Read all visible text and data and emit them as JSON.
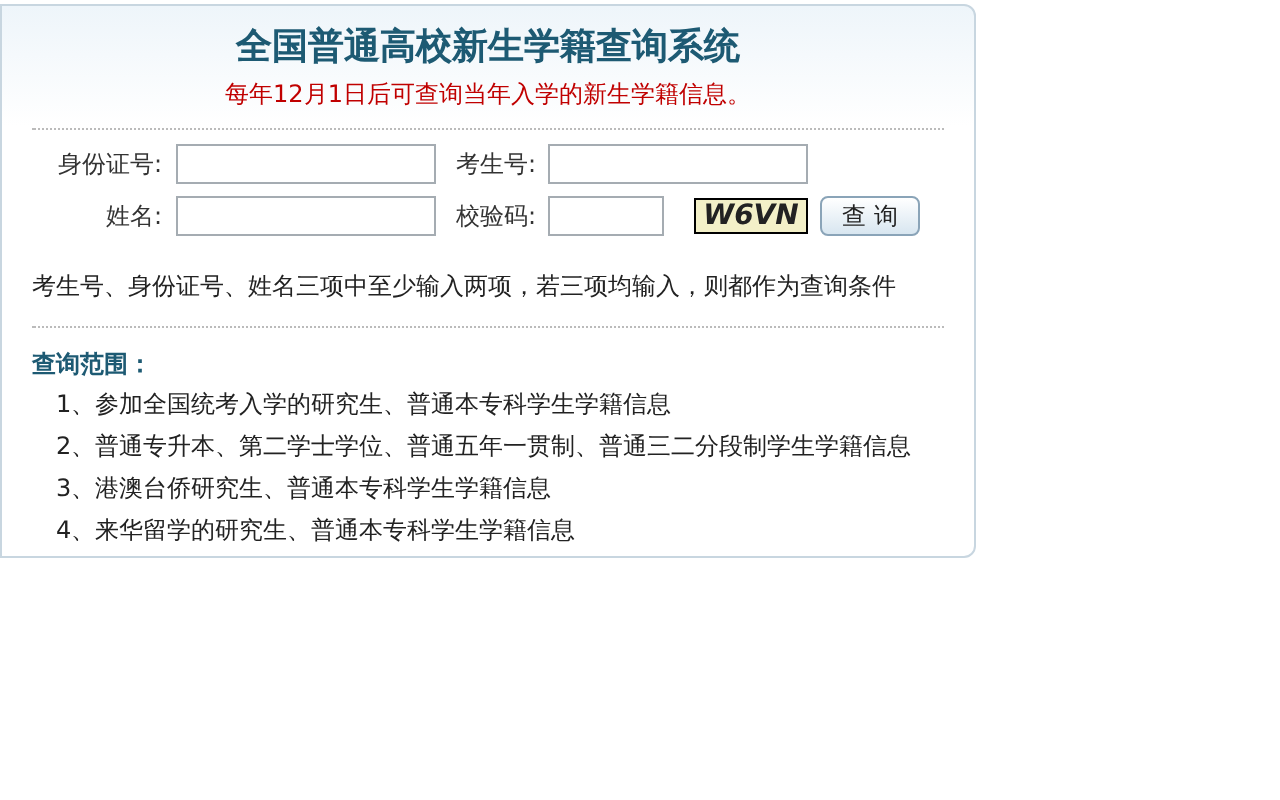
{
  "title": "全国普通高校新生学籍查询系统",
  "notice": "每年12月1日后可查询当年入学的新生学籍信息。",
  "form": {
    "rows": [
      {
        "fields": [
          {
            "label": "身份证号:"
          },
          {
            "label": "考生号:"
          }
        ]
      },
      {
        "fields": [
          {
            "label": "姓名:"
          },
          {
            "label": "校验码:"
          }
        ],
        "captcha": "W6VN",
        "button": "查 询"
      }
    ]
  },
  "hint": "考生号、身份证号、姓名三项中至少输入两项，若三项均输入，则都作为查询条件",
  "scope": {
    "heading": "查询范围：",
    "items": [
      "1、参加全国统考入学的研究生、普通本专科学生学籍信息",
      "2、普通专升本、第二学士学位、普通五年一贯制、普通三二分段制学生学籍信息",
      "3、港澳台侨研究生、普通本专科学生学籍信息",
      "4、来华留学的研究生、普通本专科学生学籍信息"
    ]
  }
}
